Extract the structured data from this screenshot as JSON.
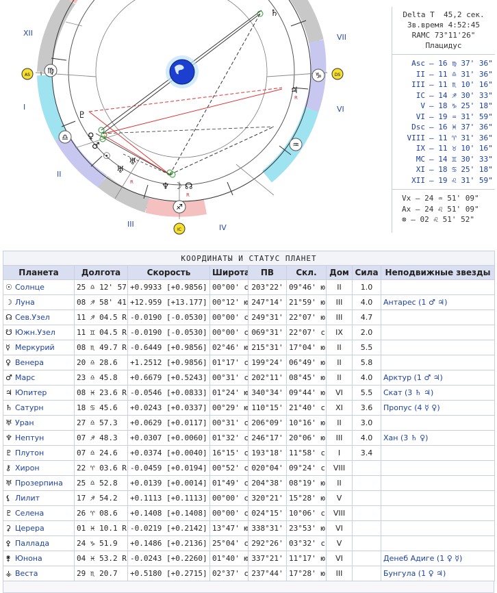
{
  "info": {
    "delta_t_label": "Delta T",
    "delta_t_value": "45,2 сек.",
    "star_time": "Зв.время 4:52:45",
    "ramc": "RAMC 73°11'26\"",
    "house_system": "Плацидус",
    "cusps": [
      {
        "label": "Asc",
        "value": "– 16 ♍ 37' 36\""
      },
      {
        "label": "II",
        "value": "– 11 ♎ 31' 36\""
      },
      {
        "label": "III",
        "value": "– 11 ♏ 10' 16\""
      },
      {
        "label": "IC",
        "value": "– 14 ♐ 30' 33\""
      },
      {
        "label": "V",
        "value": "– 18 ♑ 25' 18\""
      },
      {
        "label": "VI",
        "value": "– 19 ♒ 31' 59\""
      },
      {
        "label": "Dsc",
        "value": "– 16 ♓ 37' 36\""
      },
      {
        "label": "VIII",
        "value": "– 11 ♈ 31' 36\""
      },
      {
        "label": "IX",
        "value": "– 11 ♉ 10' 16\""
      },
      {
        "label": "MC",
        "value": "– 14 ♊ 30' 33\""
      },
      {
        "label": "XI",
        "value": "– 18 ♋ 25' 18\""
      },
      {
        "label": "XII",
        "value": "– 19 ♌ 31' 59\""
      }
    ],
    "extras": [
      "Vx – 24 ♒ 51' 09\"",
      "Ax – 24 ♌ 51' 09\"",
      "⊗ – 02 ♌ 51' 52\""
    ]
  },
  "chart": {
    "house_labels": [
      "XII",
      "I",
      "II",
      "III",
      "IV",
      "VII",
      "VI"
    ],
    "asc_badge": "AS",
    "dsc_badge": "DS",
    "ic_badge": "IC",
    "sign_glyphs": [
      "♍",
      "♎",
      "♐",
      "♒",
      "♑"
    ],
    "planet_glyphs": [
      "♄",
      "♀",
      "♂",
      "☉",
      "♅",
      "♆",
      "☽",
      "☊",
      "♃",
      "♇",
      "♅"
    ],
    "r_marks": [
      "R",
      "R",
      "R"
    ]
  },
  "table": {
    "title": "КООРДИНАТЫ И СТАТУС ПЛАНЕТ",
    "headers": [
      "Планета",
      "Долгота",
      "Скорость",
      "Широта",
      "ПВ",
      "Скл.",
      "Дом",
      "Сила",
      "Неподвижные звезды"
    ],
    "rows": [
      {
        "sym": "☉",
        "name": "Солнце",
        "lon": "25 ♎ 12' 57\"",
        "speed": "+0.9933  [+0.9856]",
        "lat": "00°00' с",
        "ra": "203°22'",
        "dec": "09°46' ю",
        "house": "II",
        "power": "1.0",
        "stars": ""
      },
      {
        "sym": "☽",
        "name": "Луна",
        "lon": "08 ♐ 58' 41\"",
        "speed": "+12.959  [+13.177]",
        "lat": "00°12' ю",
        "ra": "247°14'",
        "dec": "21°59' ю",
        "house": "III",
        "power": "4.0",
        "stars": "Антарес (1 ♂ ♃)"
      },
      {
        "sym": "☊",
        "name": "Сев.Узел",
        "lon": "11 ♐ 04.5  R",
        "speed": "-0.0190  [-0.0530]",
        "lat": "00°00' с",
        "ra": "249°31'",
        "dec": "22°07' ю",
        "house": "III",
        "power": "4.7",
        "stars": ""
      },
      {
        "sym": "☋",
        "name": "Южн.Узел",
        "lon": "11 ♊ 04.5  R",
        "speed": "-0.0190  [-0.0530]",
        "lat": "00°00' с",
        "ra": "069°31'",
        "dec": "22°07' с",
        "house": "IX",
        "power": "2.0",
        "stars": ""
      },
      {
        "sym": "☿",
        "name": "Меркурий",
        "lon": "08 ♏ 49.7  R",
        "speed": "-0.6449  [+0.9856]",
        "lat": "02°46' ю",
        "ra": "215°31'",
        "dec": "17°04' ю",
        "house": "II",
        "power": "5.5",
        "stars": ""
      },
      {
        "sym": "♀",
        "name": "Венера",
        "lon": "20 ♎ 28.6",
        "speed": "+1.2512  [+0.9856]",
        "lat": "01°17' с",
        "ra": "199°24'",
        "dec": "06°49' ю",
        "house": "II",
        "power": "5.8",
        "stars": ""
      },
      {
        "sym": "♂",
        "name": "Марс",
        "lon": "23 ♎ 45.8",
        "speed": "+0.6679  [+0.5243]",
        "lat": "00°31' с",
        "ra": "202°11'",
        "dec": "08°45' ю",
        "house": "II",
        "power": "4.0",
        "stars": "Арктур (1 ♂ ♃)"
      },
      {
        "sym": "♃",
        "name": "Юпитер",
        "lon": "08 ♓ 23.6  R",
        "speed": "-0.0546  [+0.0833]",
        "lat": "01°24' ю",
        "ra": "340°34'",
        "dec": "09°44' ю",
        "house": "VI",
        "power": "5.5",
        "stars": "Скат (3 ♄ ♃)"
      },
      {
        "sym": "♄",
        "name": "Сатурн",
        "lon": "18 ♋ 45.6",
        "speed": "+0.0243  [+0.0337]",
        "lat": "00°29' ю",
        "ra": "110°15'",
        "dec": "21°40' с",
        "house": "XI",
        "power": "3.6",
        "stars": "Пропус (4 ☿ ♀)"
      },
      {
        "sym": "♅",
        "name": "Уран",
        "lon": "27 ♎ 57.3",
        "speed": "+0.0629  [+0.0117]",
        "lat": "00°31' с",
        "ra": "206°09'",
        "dec": "10°16' ю",
        "house": "II",
        "power": "3.0",
        "stars": ""
      },
      {
        "sym": "♆",
        "name": "Нептун",
        "lon": "07 ♐ 48.3",
        "speed": "+0.0307  [+0.0060]",
        "lat": "01°32' с",
        "ra": "246°17'",
        "dec": "20°06' ю",
        "house": "III",
        "power": "4.0",
        "stars": "Хан (3 ♄ ♀)"
      },
      {
        "sym": "♇",
        "name": "Плутон",
        "lon": "07 ♎ 24.6",
        "speed": "+0.0374  [+0.0040]",
        "lat": "16°15' с",
        "ra": "193°18'",
        "dec": "11°58' с",
        "house": "I",
        "power": "3.4",
        "stars": ""
      },
      {
        "sym": "⚷",
        "name": "Хирон",
        "lon": "22 ♈ 03.6  R",
        "speed": "-0.0459  [+0.0194]",
        "lat": "00°52' с",
        "ra": "020°04'",
        "dec": "09°24' с",
        "house": "VIII",
        "power": "",
        "stars": ""
      },
      {
        "sym": "♅",
        "name": "Прозерпина",
        "lon": "25 ♎ 52.8",
        "speed": "+0.0139  [+0.0014]",
        "lat": "01°49' с",
        "ra": "204°38'",
        "dec": "08°19' ю",
        "house": "II",
        "power": "",
        "stars": ""
      },
      {
        "sym": "⚸",
        "name": "Лилит",
        "lon": "17 ♐ 54.2",
        "speed": "+0.1113  [+0.1113]",
        "lat": "00°00' с",
        "ra": "320°21'",
        "dec": "15°28' ю",
        "house": "V",
        "power": "",
        "stars": ""
      },
      {
        "sym": "♇",
        "name": "Селена",
        "lon": "26 ♈ 08.6",
        "speed": "+0.1408  [+0.1408]",
        "lat": "00°00' с",
        "ra": "024°15'",
        "dec": "10°06' с",
        "house": "VIII",
        "power": "",
        "stars": ""
      },
      {
        "sym": "⚳",
        "name": "Церера",
        "lon": "01 ♓ 10.1  R",
        "speed": "-0.0219  [+0.2142]",
        "lat": "13°47' ю",
        "ra": "338°31'",
        "dec": "23°53' ю",
        "house": "VI",
        "power": "",
        "stars": ""
      },
      {
        "sym": "⚴",
        "name": "Паллада",
        "lon": "24 ♑ 51.9",
        "speed": "+0.1486  [+0.2136]",
        "lat": "25°04' с",
        "ra": "292°26'",
        "dec": "03°32' с",
        "house": "V",
        "power": "",
        "stars": ""
      },
      {
        "sym": "⚵",
        "name": "Юнона",
        "lon": "04 ♓ 53.2  R",
        "speed": "-0.0243  [+0.2260]",
        "lat": "01°40' ю",
        "ra": "337°21'",
        "dec": "11°17' ю",
        "house": "VI",
        "power": "",
        "stars": "Денеб Адиге (1 ♀ ☿)"
      },
      {
        "sym": "⚶",
        "name": "Веста",
        "lon": "29 ♏ 20.7",
        "speed": "+0.5180  [+0.2715]",
        "lat": "02°37' с",
        "ra": "237°44'",
        "dec": "17°28' ю",
        "house": "III",
        "power": "",
        "stars": "Бунгула (1 ♀ ♃)"
      }
    ]
  }
}
